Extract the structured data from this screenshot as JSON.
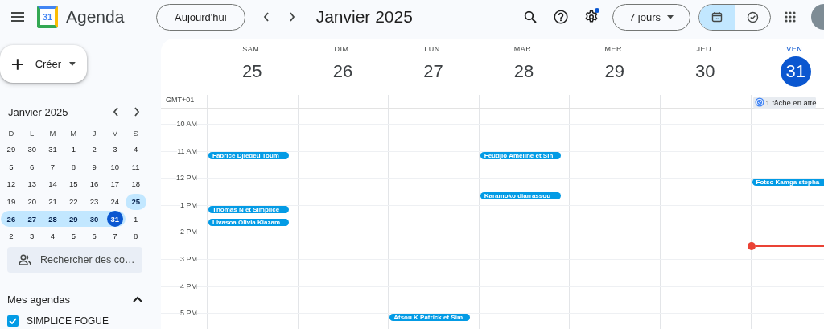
{
  "header": {
    "app_name": "Agenda",
    "logo_text": "31",
    "today_button": "Aujourd'hui",
    "title": "Janvier 2025",
    "view_select": "7 jours",
    "settings_badge": true,
    "view_toggle": [
      {
        "kind": "calendar",
        "selected": true
      },
      {
        "kind": "tasks",
        "selected": false
      }
    ]
  },
  "sidebar": {
    "create_button": "Créer",
    "mini_calendar": {
      "title": "Janvier 2025",
      "weekdays": [
        "D",
        "L",
        "M",
        "M",
        "J",
        "V",
        "S"
      ],
      "weeks": [
        {
          "days": [
            {
              "label": "29",
              "in_week": false,
              "today": false
            },
            {
              "label": "30",
              "in_week": false,
              "today": false
            },
            {
              "label": "31",
              "in_week": false,
              "today": false
            },
            {
              "label": "1",
              "in_week": false,
              "today": false
            },
            {
              "label": "2",
              "in_week": false,
              "today": false
            },
            {
              "label": "3",
              "in_week": false,
              "today": false
            },
            {
              "label": "4",
              "in_week": false,
              "today": false
            }
          ]
        },
        {
          "days": [
            {
              "label": "5",
              "in_week": false,
              "today": false
            },
            {
              "label": "6",
              "in_week": false,
              "today": false
            },
            {
              "label": "7",
              "in_week": false,
              "today": false
            },
            {
              "label": "8",
              "in_week": false,
              "today": false
            },
            {
              "label": "9",
              "in_week": false,
              "today": false
            },
            {
              "label": "10",
              "in_week": false,
              "today": false
            },
            {
              "label": "11",
              "in_week": false,
              "today": false
            }
          ]
        },
        {
          "days": [
            {
              "label": "12",
              "in_week": false,
              "today": false
            },
            {
              "label": "13",
              "in_week": false,
              "today": false
            },
            {
              "label": "14",
              "in_week": false,
              "today": false
            },
            {
              "label": "15",
              "in_week": false,
              "today": false
            },
            {
              "label": "16",
              "in_week": false,
              "today": false
            },
            {
              "label": "17",
              "in_week": false,
              "today": false
            },
            {
              "label": "18",
              "in_week": false,
              "today": false
            }
          ]
        },
        {
          "days": [
            {
              "label": "19",
              "in_week": false,
              "today": false
            },
            {
              "label": "20",
              "in_week": false,
              "today": false
            },
            {
              "label": "21",
              "in_week": false,
              "today": false
            },
            {
              "label": "22",
              "in_week": false,
              "today": false
            },
            {
              "label": "23",
              "in_week": false,
              "today": false
            },
            {
              "label": "24",
              "in_week": false,
              "today": false
            },
            {
              "label": "25",
              "in_week": true,
              "today": false
            }
          ]
        },
        {
          "days": [
            {
              "label": "26",
              "in_week": true,
              "today": false
            },
            {
              "label": "27",
              "in_week": true,
              "today": false
            },
            {
              "label": "28",
              "in_week": true,
              "today": false
            },
            {
              "label": "29",
              "in_week": true,
              "today": false
            },
            {
              "label": "30",
              "in_week": true,
              "today": false
            },
            {
              "label": "31",
              "in_week": true,
              "today": true
            },
            {
              "label": "1",
              "in_week": false,
              "today": false
            }
          ]
        },
        {
          "days": [
            {
              "label": "2",
              "in_week": false,
              "today": false
            },
            {
              "label": "3",
              "in_week": false,
              "today": false
            },
            {
              "label": "4",
              "in_week": false,
              "today": false
            },
            {
              "label": "5",
              "in_week": false,
              "today": false
            },
            {
              "label": "6",
              "in_week": false,
              "today": false
            },
            {
              "label": "7",
              "in_week": false,
              "today": false
            },
            {
              "label": "8",
              "in_week": false,
              "today": false
            }
          ]
        }
      ]
    },
    "people_search": {
      "placeholder": "Rechercher des co…"
    },
    "my_calendars": {
      "title": "Mes agendas",
      "expanded": true,
      "items": [
        {
          "name": "SIMPLICE FOGUE",
          "checked": true,
          "color": "#039be5"
        }
      ]
    }
  },
  "grid": {
    "timezone": "GMT+01",
    "days": [
      {
        "weekday": "SAM.",
        "date": "25",
        "selected": false
      },
      {
        "weekday": "DIM.",
        "date": "26",
        "selected": false
      },
      {
        "weekday": "LUN.",
        "date": "27",
        "selected": false
      },
      {
        "weekday": "MAR.",
        "date": "28",
        "selected": false
      },
      {
        "weekday": "MER.",
        "date": "29",
        "selected": false
      },
      {
        "weekday": "JEU.",
        "date": "30",
        "selected": false
      },
      {
        "weekday": "VEN.",
        "date": "31",
        "selected": true,
        "task": "1 tâche en atte"
      }
    ],
    "rows": [
      {
        "label": "10 AM",
        "cells": [
          {},
          {},
          {},
          {},
          {},
          {},
          {}
        ]
      },
      {
        "label": "11 AM",
        "cells": [
          {
            "events": [
              {
                "title": "Fabrice Djiedeu Toum",
                "late": false
              }
            ]
          },
          {},
          {},
          {
            "events": [
              {
                "title": "Feudjio Ameline et Sin",
                "late": false
              }
            ]
          },
          {},
          {},
          {}
        ]
      },
      {
        "label": "12 PM",
        "cells": [
          {},
          {},
          {},
          {
            "events": [
              {
                "title": "Karamoko diarrassou",
                "late": true
              }
            ]
          },
          {},
          {},
          {
            "events": [
              {
                "title": "Fotso Kamga stepha",
                "late": false
              }
            ]
          }
        ]
      },
      {
        "label": "1 PM",
        "cells": [
          {
            "events": [
              {
                "title": "Thomas N et Simplice",
                "late": false
              },
              {
                "title": "Livasoa Olivia Kiazam",
                "late": true
              }
            ]
          },
          {},
          {},
          {},
          {},
          {},
          {}
        ]
      },
      {
        "label": "2 PM",
        "cells": [
          {},
          {},
          {},
          {},
          {},
          {},
          {
            "now": true
          }
        ]
      },
      {
        "label": "3 PM",
        "cells": [
          {},
          {},
          {},
          {},
          {},
          {},
          {}
        ]
      },
      {
        "label": "4 PM",
        "cells": [
          {},
          {},
          {},
          {},
          {},
          {},
          {}
        ]
      },
      {
        "label": "5 PM",
        "cells": [
          {},
          {},
          {
            "events": [
              {
                "title": "Atsou K.Patrick et Sim",
                "late": false
              }
            ]
          },
          {},
          {},
          {},
          {}
        ]
      }
    ]
  }
}
